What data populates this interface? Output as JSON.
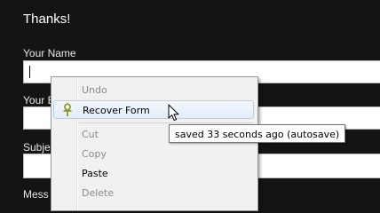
{
  "form": {
    "heading": "Thanks!",
    "name_label": "Your Name",
    "email_label": "Your E",
    "subject_label": "Subje",
    "message_label": "Mess"
  },
  "context_menu": {
    "items": [
      {
        "label": "Undo",
        "enabled": false
      },
      {
        "label": "Recover Form",
        "enabled": true,
        "icon": "ankh-icon",
        "highlighted": true
      },
      {
        "label": "Cut",
        "enabled": false
      },
      {
        "label": "Copy",
        "enabled": false
      },
      {
        "label": "Paste",
        "enabled": true
      },
      {
        "label": "Delete",
        "enabled": false
      }
    ]
  },
  "tooltip": {
    "text": "saved 33 seconds ago (autosave)"
  },
  "colors": {
    "background": "#141414",
    "menu_background": "#f1f1f1",
    "highlight_border": "#aecff7",
    "icon_color": "#8c9a2a"
  }
}
